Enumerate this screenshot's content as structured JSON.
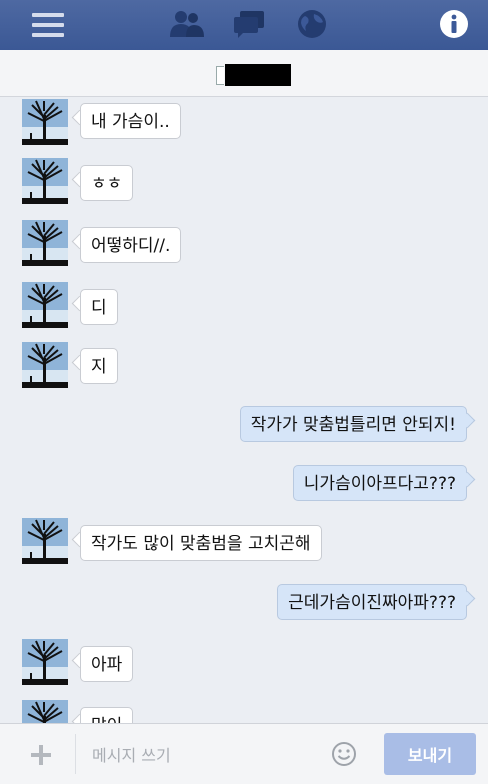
{
  "colors": {
    "topbar": "#3c5998",
    "bubble_in": "#ffffff",
    "bubble_out": "#d6e5f8",
    "send_button": "#a9bde6"
  },
  "topbar": {
    "icons": [
      "menu-icon",
      "friends-icon",
      "messages-icon",
      "globe-icon",
      "info-icon"
    ]
  },
  "conversation": {
    "name_redacted": true
  },
  "messages": [
    {
      "from": "them",
      "text": "내 가슴이.."
    },
    {
      "from": "them",
      "text": "ㅎㅎ"
    },
    {
      "from": "them",
      "text": "어떻하디//."
    },
    {
      "from": "them",
      "text": "디"
    },
    {
      "from": "them",
      "text": "지"
    },
    {
      "from": "me",
      "text": "작가가 맞춤법틀리면 안되지!"
    },
    {
      "from": "me",
      "text": "니가슴이아프다고???"
    },
    {
      "from": "them",
      "text": "작가도 많이 맞춤범을 고치곤해"
    },
    {
      "from": "me",
      "text": "근데가슴이진짜아파???"
    },
    {
      "from": "them",
      "text": "아파"
    },
    {
      "from": "them",
      "text": "많이"
    }
  ],
  "composer": {
    "placeholder": "메시지 쓰기",
    "send_label": "보내기"
  }
}
